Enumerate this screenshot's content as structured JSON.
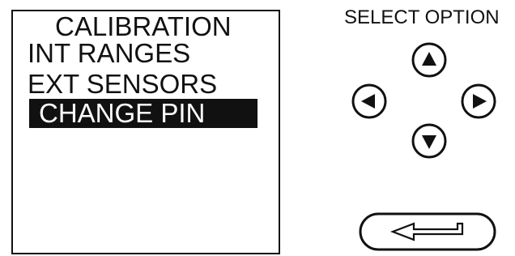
{
  "display": {
    "title": "CALIBRATION",
    "items": [
      {
        "label": "INT RANGES",
        "selected": false
      },
      {
        "label": "EXT SENSORS",
        "selected": false
      },
      {
        "label": "CHANGE  PIN",
        "selected": true
      }
    ]
  },
  "controls": {
    "label": "SELECT OPTION",
    "buttons": {
      "up": {
        "icon": "triangle-up-icon"
      },
      "left": {
        "icon": "triangle-left-icon"
      },
      "right": {
        "icon": "triangle-right-icon"
      },
      "down": {
        "icon": "triangle-down-icon"
      },
      "enter": {
        "icon": "enter-arrow-icon"
      }
    }
  },
  "colors": {
    "foreground": "#111111",
    "background": "#ffffff",
    "selection_text": "#ffffff"
  }
}
